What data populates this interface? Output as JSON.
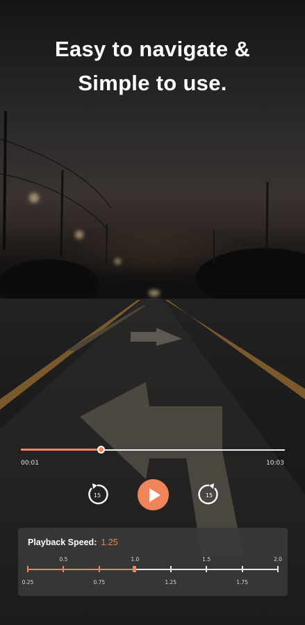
{
  "headline": {
    "line1": "Easy to navigate &",
    "line2": "Simple to use."
  },
  "player": {
    "current_time": "00:01",
    "total_time": "10:03",
    "progress_fraction": 0.305,
    "rewind_label": "15",
    "forward_label": "15",
    "rewind_icon": "rewind-15-icon",
    "forward_icon": "forward-15-icon",
    "play_icon": "play-icon",
    "accent_color": "#f0845a"
  },
  "speed": {
    "title": "Playback Speed:",
    "value": "1.25",
    "current": 1.25,
    "top_labels": [
      "0.5",
      "1.0",
      "1.5",
      "2.0"
    ],
    "bottom_labels": [
      "0.25",
      "0.75",
      "1.25",
      "1.75"
    ]
  }
}
